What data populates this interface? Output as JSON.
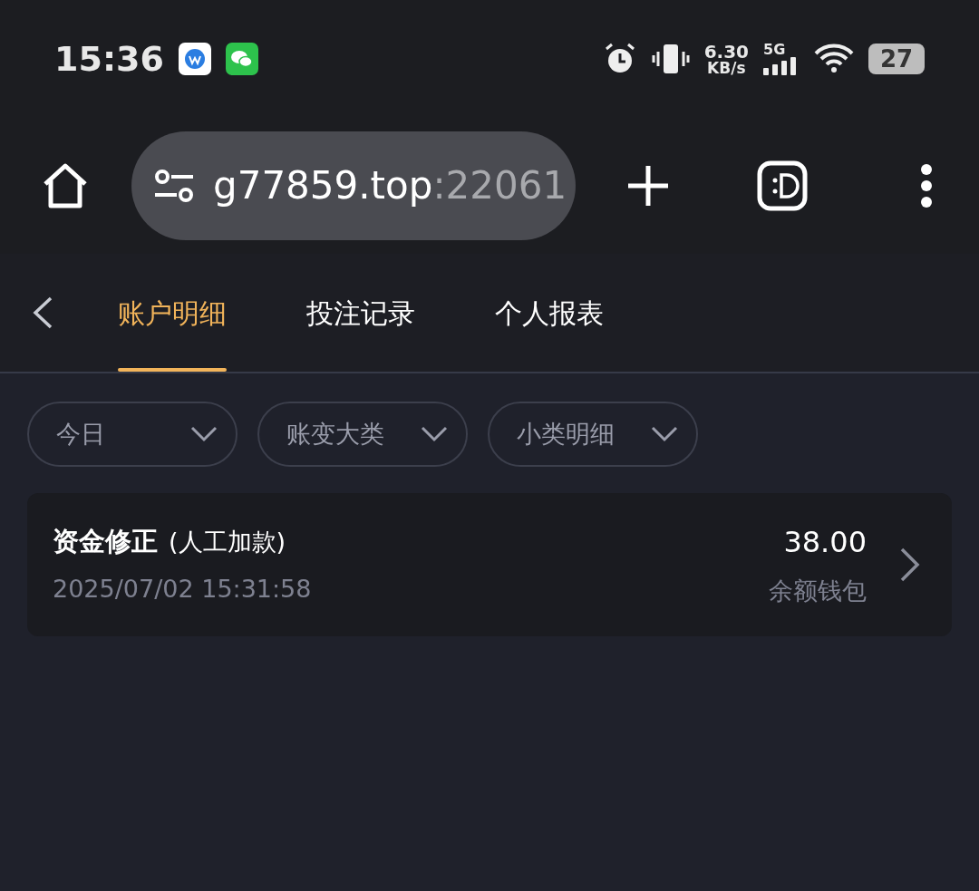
{
  "status_bar": {
    "time": "15:36",
    "speed_value": "6.30",
    "speed_unit": "KB/s",
    "network": "5G",
    "battery": "27"
  },
  "browser": {
    "url_host": "g77859.top",
    "url_port": ":22061"
  },
  "tabs": [
    {
      "label": "账户明细",
      "selected": true
    },
    {
      "label": "投注记录",
      "selected": false
    },
    {
      "label": "个人报表",
      "selected": false
    }
  ],
  "filters": [
    {
      "label": "今日"
    },
    {
      "label": "账变大类"
    },
    {
      "label": "小类明细"
    }
  ],
  "records": [
    {
      "title": "资金修正",
      "subtitle": "(人工加款)",
      "time": "2025/07/02 15:31:58",
      "amount": "38.00",
      "wallet": "余额钱包"
    }
  ]
}
